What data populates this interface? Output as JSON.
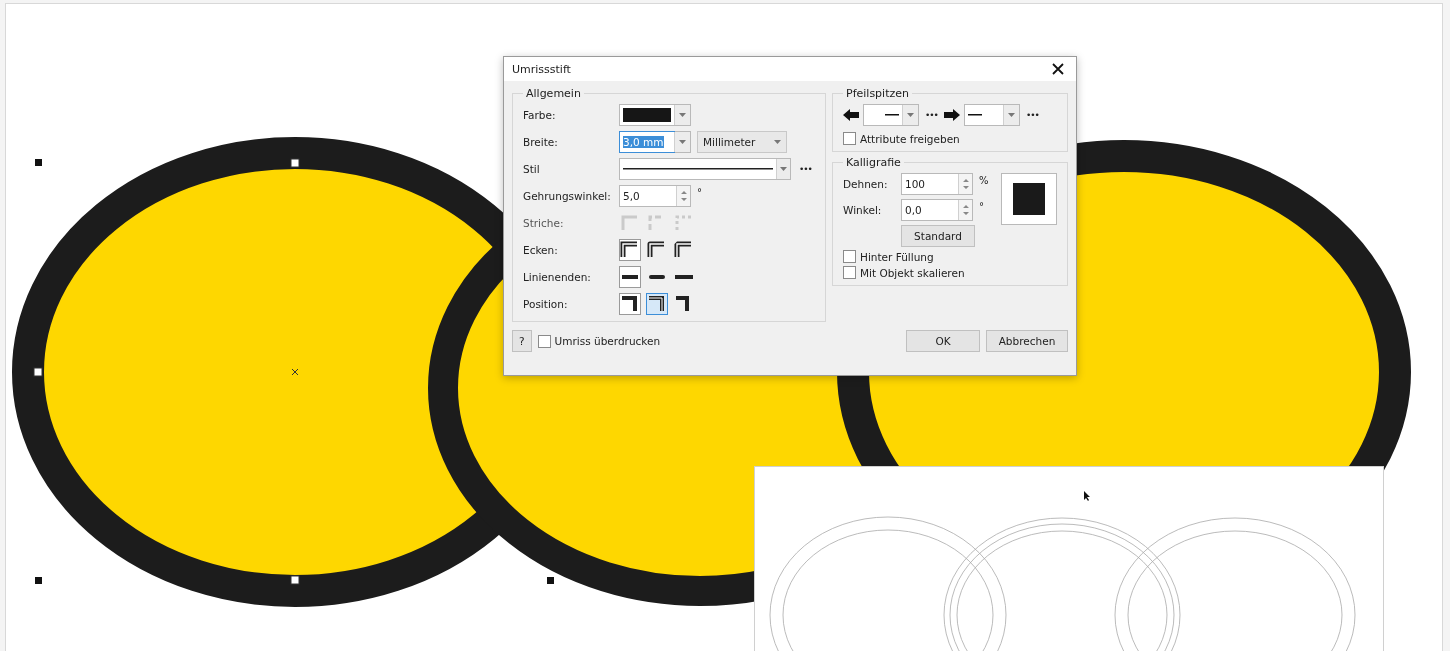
{
  "dialog": {
    "title": "Umrissstift",
    "general": {
      "title": "Allgemein",
      "color_label": "Farbe:",
      "width_label": "Breite:",
      "width_value": "3,0 mm",
      "unit": "Millimeter",
      "style_label": "Stil",
      "style_more": "•••",
      "miter_label": "Gehrungswinkel:",
      "miter_value": "5,0",
      "miter_unit": "°",
      "dashes_label": "Striche:",
      "dashes_disabled": true,
      "corners_label": "Ecken:",
      "corners": [
        {
          "selected": true
        },
        {
          "selected": false
        },
        {
          "selected": false
        }
      ],
      "line_caps_label": "Linienenden:",
      "line_caps": [
        {
          "selected": true
        },
        {
          "selected": false
        },
        {
          "selected": false
        }
      ],
      "position_label": "Position:",
      "positions": [
        {
          "selected": true,
          "hovered": false
        },
        {
          "selected": false,
          "hovered": true
        },
        {
          "selected": false,
          "hovered": false
        }
      ]
    },
    "arrowheads": {
      "title": "Pfeilspitzen",
      "start_more": "•••",
      "end_more": "•••",
      "share_label": "Attribute freigeben",
      "share_checked": false
    },
    "calligraphy": {
      "title": "Kalligrafie",
      "stretch_label": "Dehnen:",
      "stretch_value": "100",
      "stretch_unit": "%",
      "angle_label": "Winkel:",
      "angle_value": "0,0",
      "angle_unit": "°",
      "default_button": "Standard",
      "options": [
        {
          "label": "Hinter Füllung",
          "checked": false
        },
        {
          "label": "Mit Objekt skalieren",
          "checked": false
        }
      ]
    },
    "footer": {
      "help": "?",
      "overprint_label": "Umriss überdrucken",
      "overprint_checked": false,
      "ok": "OK",
      "cancel": "Abbrechen"
    }
  }
}
